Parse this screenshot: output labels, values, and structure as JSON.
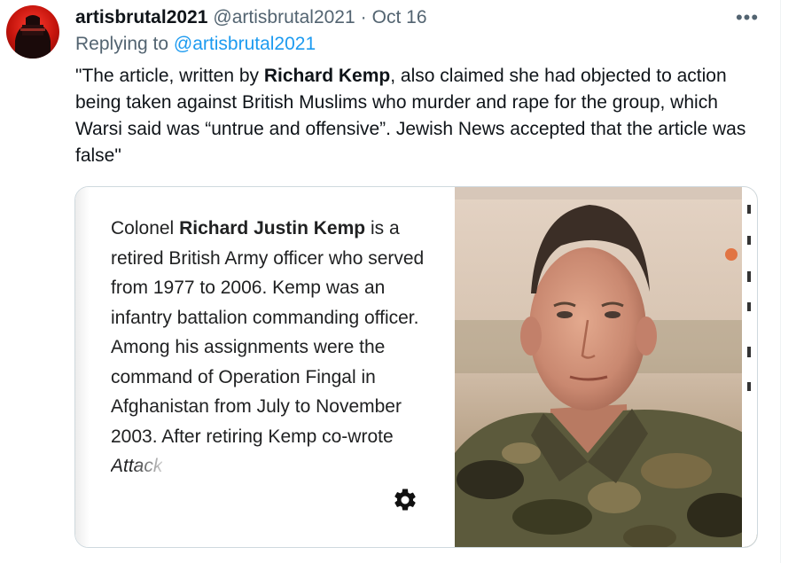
{
  "tweet": {
    "author_name": "artisbrutal2021",
    "author_handle": "@artisbrutal2021",
    "separator": "·",
    "date": "Oct 16",
    "replying_prefix": "Replying to",
    "replying_to": "@artisbrutal2021",
    "text": {
      "part1": "\"The article, written by ",
      "bold": "Richard Kemp",
      "part2": ",  also claimed she had objected to action being taken against British  Muslims who murder and rape for the group, which Warsi said was “untrue  and offensive”. Jewish News accepted that the article was false\""
    },
    "more_icon": "more-horizontal-icon"
  },
  "card": {
    "text": {
      "intro": "Colonel ",
      "bold": "Richard Justin Kemp",
      "body": " is a retired British Army officer who served from 1977 to 2006. Kemp was an infantry battalion commanding officer. Among his assignments were the command of Operation Fingal in Afghanistan from July to November 2003. After retiring Kemp co-wrote ",
      "italic": "Attack"
    },
    "settings_icon": "gear-icon",
    "photo_icon": "portrait-photo"
  },
  "colors": {
    "link": "#1d9bf0",
    "secondary_text": "#536471",
    "primary_text": "#0f1419",
    "card_border": "#cfd9de"
  }
}
